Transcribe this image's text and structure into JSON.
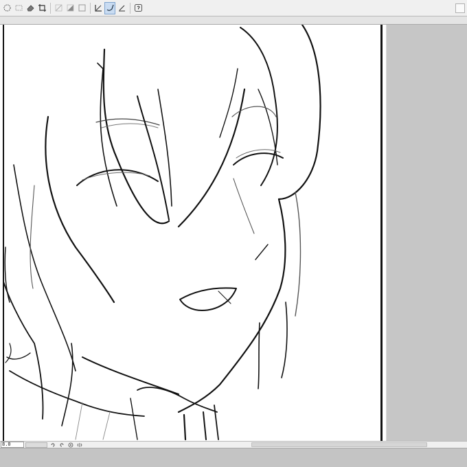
{
  "toolbar": {
    "tools": [
      {
        "name": "lasso-icon",
        "active": false
      },
      {
        "name": "rect-select-icon",
        "active": false
      },
      {
        "name": "eraser-icon",
        "active": false
      },
      {
        "name": "crop-icon",
        "active": false
      },
      {
        "name": "fill-icon",
        "active": false
      },
      {
        "name": "gradient-icon",
        "active": false
      },
      {
        "name": "frame-icon",
        "active": false
      },
      {
        "name": "ruler-icon",
        "active": false
      },
      {
        "name": "brush-icon",
        "active": true
      },
      {
        "name": "pen-icon",
        "active": false
      },
      {
        "name": "help-icon",
        "active": false
      }
    ]
  },
  "status": {
    "zoom": "8.0"
  },
  "colors": {
    "toolbar_bg": "#f0f0f0",
    "workspace_bg": "#c8c8c8",
    "canvas_bg": "#ffffff",
    "active_tool": "#c9dcf2",
    "line_art": "#111111"
  }
}
